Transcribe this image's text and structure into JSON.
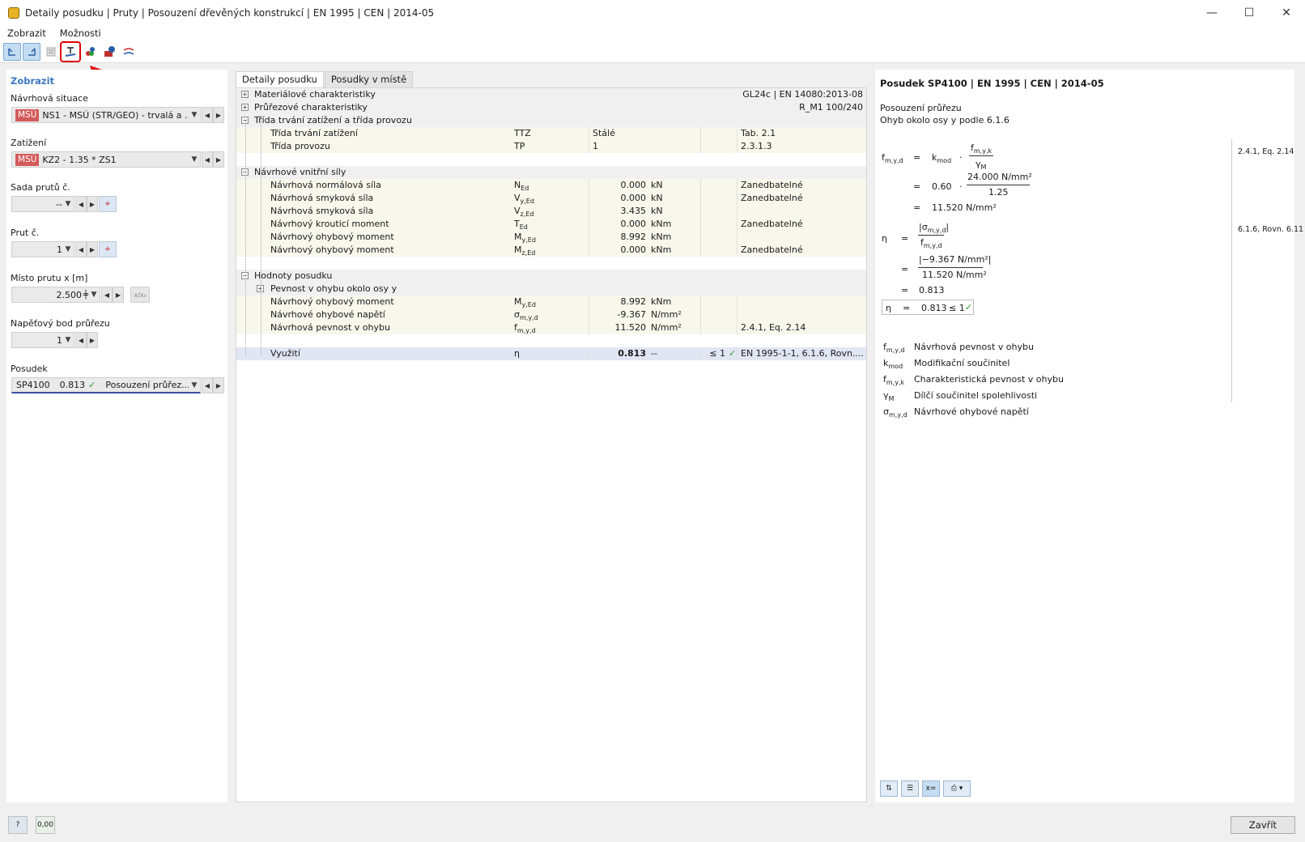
{
  "window": {
    "title": "Detaily posudku | Pruty | Posouzení dřevěných konstrukcí | EN 1995 | CEN | 2014-05",
    "minimize": "—",
    "maximize": "☐",
    "close": "✕"
  },
  "menu": [
    "Zobrazit",
    "Možnosti"
  ],
  "toolbar": {
    "icons": [
      "arrow-left-icon",
      "arrow-right-icon",
      "layout-icon",
      "member-section-icon",
      "load-combination-icon",
      "design-info-icon",
      "stress-icon"
    ]
  },
  "left": {
    "heading": "Zobrazit",
    "design_situation_label": "Návrhová situace",
    "design_situation_tag": "MSÚ",
    "design_situation_value": "NS1 - MSÚ (STR/GEO) - trvalá a ...",
    "load_label": "Zatížení",
    "load_tag": "MSÚ",
    "load_value": "KZ2 - 1.35 * ZS1",
    "member_set_label": "Sada prutů č.",
    "member_set_value": "--",
    "member_label": "Prut č.",
    "member_value": "1",
    "location_label": "Místo prutu x [m]",
    "location_value": "2.500",
    "location_ratio": "x/x₀",
    "stress_point_label": "Napěťový bod průřezu",
    "stress_point_value": "1",
    "check_label": "Posudek",
    "check_id": "SP4100",
    "check_ratio": "0.813",
    "check_name": "Posouzení průřez..."
  },
  "tabs": [
    "Detaily posudku",
    "Posudky v místě"
  ],
  "grid": {
    "rows": [
      {
        "type": "sec",
        "exp": "+",
        "name": "Materiálové charakteristiky",
        "ref": "GL24c | EN 14080:2013-08"
      },
      {
        "type": "sec",
        "exp": "+",
        "name": "Průřezové charakteristiky",
        "ref": "R_M1 100/240"
      },
      {
        "type": "sec",
        "exp": "−",
        "name": "Třída trvání zatížení a třída provozu"
      },
      {
        "type": "data",
        "name": "Třída trvání zatížení",
        "sym": "TTZ",
        "val": "Stálé",
        "ref": "Tab. 2.1"
      },
      {
        "type": "data",
        "name": "Třída provozu",
        "sym": "TP",
        "val": "1",
        "ref": "2.3.1.3"
      },
      {
        "type": "blank"
      },
      {
        "type": "sec",
        "exp": "−",
        "name": "Návrhové vnitřní síly"
      },
      {
        "type": "data",
        "name": "Návrhová normálová síla",
        "sym": "N",
        "sub": "Ed",
        "num": "0.000",
        "unit": "kN",
        "ref": "Zanedbatelné"
      },
      {
        "type": "data",
        "name": "Návrhová smyková síla",
        "sym": "V",
        "sub": "y,Ed",
        "num": "0.000",
        "unit": "kN",
        "ref": "Zanedbatelné"
      },
      {
        "type": "data",
        "name": "Návrhová smyková síla",
        "sym": "V",
        "sub": "z,Ed",
        "num": "3.435",
        "unit": "kN",
        "ref": ""
      },
      {
        "type": "data",
        "name": "Návrhový krouticí moment",
        "sym": "T",
        "sub": "Ed",
        "num": "0.000",
        "unit": "kNm",
        "ref": "Zanedbatelné"
      },
      {
        "type": "data",
        "name": "Návrhový ohybový moment",
        "sym": "M",
        "sub": "y,Ed",
        "num": "8.992",
        "unit": "kNm",
        "ref": ""
      },
      {
        "type": "data",
        "name": "Návrhový ohybový moment",
        "sym": "M",
        "sub": "z,Ed",
        "num": "0.000",
        "unit": "kNm",
        "ref": "Zanedbatelné"
      },
      {
        "type": "blank"
      },
      {
        "type": "sec",
        "exp": "−",
        "name": "Hodnoty posudku"
      },
      {
        "type": "sub",
        "exp": "+",
        "name": "Pevnost v ohybu okolo osy y"
      },
      {
        "type": "data",
        "name": "Návrhový ohybový moment",
        "sym": "M",
        "sub": "y,Ed",
        "num": "8.992",
        "unit": "kNm",
        "ref": ""
      },
      {
        "type": "data",
        "name": "Návrhové ohybové napětí",
        "sym": "σ",
        "sub": "m,y,d",
        "num": "-9.367",
        "unit": "N/mm²",
        "ref": ""
      },
      {
        "type": "data",
        "name": "Návrhová pevnost v ohybu",
        "sym": "f",
        "sub": "m,y,d",
        "num": "11.520",
        "unit": "N/mm²",
        "ref": "2.4.1, Eq. 2.14"
      },
      {
        "type": "blank"
      },
      {
        "type": "util",
        "name": "Využití",
        "sym": "η",
        "num": "0.813",
        "unit": "--",
        "lim": "≤ 1",
        "ref": "EN 1995-1-1, 6.1.6, Rovn...."
      }
    ]
  },
  "right": {
    "title": "Posudek SP4100 | EN 1995 | CEN | 2014-05",
    "subtitle1": "Posouzení průřezu",
    "subtitle2": "Ohyb okolo osy y podle 6.1.6",
    "eq1_ref": "2.4.1, Eq. 2.14",
    "eq2_ref": "6.1.6, Rovn. 6.11",
    "fmyd": "f",
    "fmyd_sub": "m,y,d",
    "kmod": "k",
    "kmod_sub": "mod",
    "fmyk": "f",
    "fmyk_sub": "m,y,k",
    "gammaM": "γ",
    "gammaM_sub": "M",
    "kmod_val": "0.60",
    "fmyk_val": "24.000 N/mm²",
    "gammaM_val": "1.25",
    "fmyd_val": "11.520 N/mm²",
    "eta": "η",
    "sigma": "σ",
    "sigma_sub": "m,y,d",
    "sigma_val": "−9.367 N/mm²",
    "fmyd_val2": "11.520 N/mm²",
    "eta_val": "0.813",
    "result": "0.813",
    "result_lim": "≤ 1",
    "eq_sign": "=",
    "dot": "·",
    "legend": [
      {
        "sym": "f",
        "sub": "m,y,d",
        "text": "Návrhová pevnost v ohybu"
      },
      {
        "sym": "k",
        "sub": "mod",
        "text": "Modifikační součinitel"
      },
      {
        "sym": "f",
        "sub": "m,y,k",
        "text": "Charakteristická pevnost v ohybu"
      },
      {
        "sym": "γ",
        "sub": "M",
        "text": "Dílčí součinitel spolehlivosti"
      },
      {
        "sym": "σ",
        "sub": "m,y,d",
        "text": "Návrhové ohybové napětí"
      }
    ]
  },
  "status": {
    "decimals_icon": "0,00",
    "close_label": "Zavřít"
  }
}
